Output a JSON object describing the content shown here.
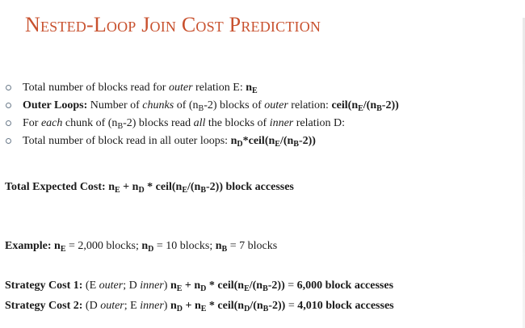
{
  "slide": {
    "title": "Nested-Loop Join Cost Prediction",
    "bullets": [
      [
        {
          "t": "Total number of blocks read for "
        },
        {
          "t": "outer",
          "i": true
        },
        {
          "t": " relation E: "
        },
        {
          "t": "n",
          "b": true
        },
        {
          "t": "E",
          "sub": true,
          "b": true
        }
      ],
      [
        {
          "t": "Outer Loops:",
          "b": true
        },
        {
          "t": " Number of "
        },
        {
          "t": "chunks",
          "i": true
        },
        {
          "t": " of (n"
        },
        {
          "t": "B",
          "sub": true
        },
        {
          "t": "-2) blocks of "
        },
        {
          "t": "outer",
          "i": true
        },
        {
          "t": " relation: "
        },
        {
          "t": "ceil(n",
          "b": true
        },
        {
          "t": "E",
          "sub": true,
          "b": true
        },
        {
          "t": "/(n",
          "b": true
        },
        {
          "t": "B",
          "sub": true,
          "b": true
        },
        {
          "t": "-2))",
          "b": true
        }
      ],
      [
        {
          "t": "For "
        },
        {
          "t": "each",
          "i": true
        },
        {
          "t": " chunk of (n"
        },
        {
          "t": "B",
          "sub": true
        },
        {
          "t": "-2) blocks read "
        },
        {
          "t": "all",
          "i": true
        },
        {
          "t": " the blocks of "
        },
        {
          "t": "inner",
          "i": true
        },
        {
          "t": " relation D:"
        }
      ],
      [
        {
          "t": "Total number of block read in all outer loops: "
        },
        {
          "t": "n",
          "b": true
        },
        {
          "t": "D",
          "sub": true,
          "b": true
        },
        {
          "t": "*ceil(n",
          "b": true
        },
        {
          "t": "E",
          "sub": true,
          "b": true
        },
        {
          "t": "/(n",
          "b": true
        },
        {
          "t": "B",
          "sub": true,
          "b": true
        },
        {
          "t": "-2))",
          "b": true
        }
      ]
    ],
    "total_cost": [
      {
        "t": "Total Expected Cost: n",
        "b": true
      },
      {
        "t": "E",
        "sub": true,
        "b": true
      },
      {
        "t": " + n",
        "b": true
      },
      {
        "t": "D",
        "sub": true,
        "b": true
      },
      {
        "t": " * ceil(n",
        "b": true
      },
      {
        "t": "E",
        "sub": true,
        "b": true
      },
      {
        "t": "/(n",
        "b": true
      },
      {
        "t": "B",
        "sub": true,
        "b": true
      },
      {
        "t": "-2)) block accesses",
        "b": true
      }
    ],
    "example": [
      {
        "t": "Example: n",
        "b": true
      },
      {
        "t": "E",
        "sub": true,
        "b": true
      },
      {
        "t": " = 2,000 blocks; "
      },
      {
        "t": "n",
        "b": true
      },
      {
        "t": "D",
        "sub": true,
        "b": true
      },
      {
        "t": " = 10 blocks; "
      },
      {
        "t": "n",
        "b": true
      },
      {
        "t": "B",
        "sub": true,
        "b": true
      },
      {
        "t": " = 7 blocks"
      }
    ],
    "strategy1": [
      {
        "t": "Strategy Cost 1: ",
        "b": true
      },
      {
        "t": "(E "
      },
      {
        "t": "outer",
        "i": true
      },
      {
        "t": "; D "
      },
      {
        "t": "inner",
        "i": true
      },
      {
        "t": ") "
      },
      {
        "t": "n",
        "b": true
      },
      {
        "t": "E",
        "sub": true,
        "b": true
      },
      {
        "t": " + n",
        "b": true
      },
      {
        "t": "D",
        "sub": true,
        "b": true
      },
      {
        "t": " * ceil(n",
        "b": true
      },
      {
        "t": "E",
        "sub": true,
        "b": true
      },
      {
        "t": "/(n",
        "b": true
      },
      {
        "t": "B",
        "sub": true,
        "b": true
      },
      {
        "t": "-2))",
        "b": true
      },
      {
        "t": " = "
      },
      {
        "t": "6,000 block accesses",
        "b": true
      }
    ],
    "strategy2": [
      {
        "t": "Strategy Cost 2: ",
        "b": true
      },
      {
        "t": "(D "
      },
      {
        "t": "outer",
        "i": true
      },
      {
        "t": "; E "
      },
      {
        "t": "inner",
        "i": true
      },
      {
        "t": ") "
      },
      {
        "t": "n",
        "b": true
      },
      {
        "t": "D",
        "sub": true,
        "b": true
      },
      {
        "t": " + n",
        "b": true
      },
      {
        "t": "E",
        "sub": true,
        "b": true
      },
      {
        "t": " * ceil(n",
        "b": true
      },
      {
        "t": "D",
        "sub": true,
        "b": true
      },
      {
        "t": "/(n",
        "b": true
      },
      {
        "t": "B",
        "sub": true,
        "b": true
      },
      {
        "t": "-2))",
        "b": true
      },
      {
        "t": " = "
      },
      {
        "t": "4,010 block accesses",
        "b": true
      }
    ]
  }
}
